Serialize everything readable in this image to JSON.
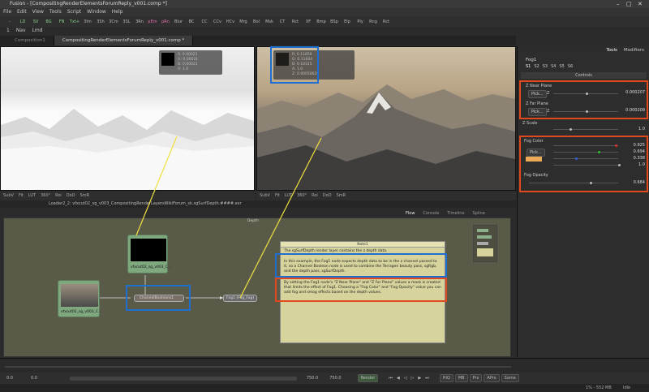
{
  "window": {
    "title": "Fusion - [CompositingRenderElementsForumReply_v001.comp *]"
  },
  "menu": [
    "File",
    "Edit",
    "View",
    "Tools",
    "Script",
    "Window",
    "Help"
  ],
  "toolbar": [
    "-",
    "LD",
    "SV",
    "BG",
    "FN",
    "Txt+",
    "3Im",
    "3Sh",
    "3Cm",
    "3SL",
    "3Rn",
    "pEm",
    "pRn",
    "Blur",
    "BC",
    "CC",
    "CCv",
    "HCv",
    "Mrg",
    "Bol",
    "Msk",
    "CT",
    "Rct",
    "XF",
    "Bmp",
    "BSp",
    "Elp",
    "Ply",
    "Rng",
    "Rct"
  ],
  "toolbar2": [
    "1",
    "Nav",
    "Lmd"
  ],
  "tabs": [
    "Composition1",
    "CompositingRenderElementsForumReply_v001.comp *"
  ],
  "viewer1": {
    "pixel": {
      "r": "R: 0.00021",
      "g": "G: 0.00021",
      "b": "B: 0.00021",
      "a": "A: 1.0"
    },
    "toolbar": [
      "SubV",
      "Fit",
      "LUT",
      "360°",
      "Roi",
      "DoD",
      "SmR"
    ],
    "status": "Loader2_2: vfxcut02_sg_v003_CompositingRenderLayersWikiForum_sk.sgSurfDepth.####.exr"
  },
  "viewer2": {
    "pixel": {
      "r": "R: 0.11859",
      "g": "G: 0.11604",
      "b": "B: 0.10315",
      "a": "A: 1.0",
      "z": "Z: 0.00058629"
    },
    "toolbar": [
      "SubV",
      "Fit",
      "LUT",
      "360°",
      "Roi",
      "DoD",
      "SmR"
    ]
  },
  "nodeTabs": [
    "Flow",
    "Console",
    "Timeline",
    "Spline"
  ],
  "flow": {
    "title": "Depth",
    "nodes": {
      "depth": "vfxcut02_sg_v003_C...",
      "beauty": "vfxcut02_sg_v003_C...",
      "boolean": "ChannelBooleans1",
      "fog": "Fog1 (Fog_Fog)"
    },
    "note": {
      "title": "Note1",
      "lines": [
        "The sgSurfDepth render layer contains the z depth data.",
        "In this example, the Fog1 node expects depth data to be in the z channel passed to it, so a Channel Boolean node is used to combine the Terragen beauty pass, sgRgb, and the depth pass, sgSurfDepth.",
        "By setting the Fog1 node's \"Z Near Plane\" and \"Z Far Plane\" values a mask is created that limits the effect of Fog1.   Choosing a \"Fog Color\" and \"Fog Opacity\" value you can add fog and smog effects based on the depth values."
      ]
    }
  },
  "inspector": {
    "tabs": [
      "Tools",
      "Modifiers"
    ],
    "node": "Fog1",
    "subtabs": [
      "S1",
      "S2",
      "S3",
      "S4",
      "S5",
      "S6"
    ],
    "section": "Controls",
    "params": {
      "zNear": {
        "label": "Z Near Plane",
        "pick": "Pick...",
        "axis": "Z",
        "value": "0.000207"
      },
      "zFar": {
        "label": "Z Far Plane",
        "pick": "Pick...",
        "axis": "Z",
        "value": "0.000208"
      },
      "zScale": {
        "label": "Z Scale",
        "value": "1.0"
      },
      "fogColor": {
        "label": "Fog Color",
        "pick": "Pick...",
        "r": "0.925",
        "g": "0.694",
        "b": "0.338",
        "a": "1.0",
        "swatch": "#eca956"
      },
      "fogOpacity": {
        "label": "Fog Opacity",
        "value": "0.684"
      }
    }
  },
  "transport": {
    "start": "0.0",
    "current": "0.0",
    "end": "750.0",
    "end2": "750.0",
    "render": "Render",
    "buttons": [
      "HiQ",
      "MB",
      "Prx",
      "APrx",
      "Some"
    ]
  },
  "status": {
    "memory": "1% - 552 MB",
    "state": "Idle"
  },
  "colors": {
    "highlightRed": "#e0491e",
    "highlightBlue": "#1e6fd0",
    "annotation": "#f0e040",
    "noteBg": "#d6d49c"
  }
}
